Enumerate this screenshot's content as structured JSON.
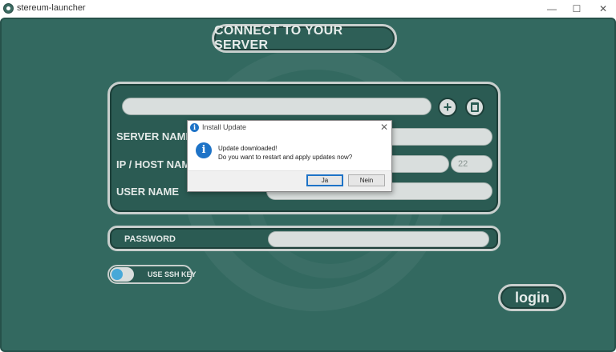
{
  "window": {
    "title": "stereum-launcher",
    "controls": {
      "minimize": "—",
      "maximize": "☐",
      "close": "✕"
    }
  },
  "main": {
    "heading": "CONNECT TO YOUR SERVER",
    "add_symbol": "+",
    "labels": {
      "server_name": "SERVER NAME",
      "ip_host": "IP / HOST NAME",
      "user_name": "USER NAME",
      "password": "PASSWORD",
      "ssh_key": "USE SSH KEY"
    },
    "port_placeholder": "22",
    "ssh_key_enabled": false,
    "login_label": "login"
  },
  "dialog": {
    "title": "Install Update",
    "close_symbol": "✕",
    "info_symbol": "i",
    "message_line1": "Update downloaded!",
    "message_line2": "Do you want to restart and apply updates now?",
    "yes_label": "Ja",
    "no_label": "Nein"
  },
  "colors": {
    "background": "#336960",
    "panel": "#2b5b53",
    "border": "#c8cfcd",
    "field": "#d9dedd",
    "toggle_knob": "#47a8d8",
    "dialog_accent": "#1e73c7"
  }
}
